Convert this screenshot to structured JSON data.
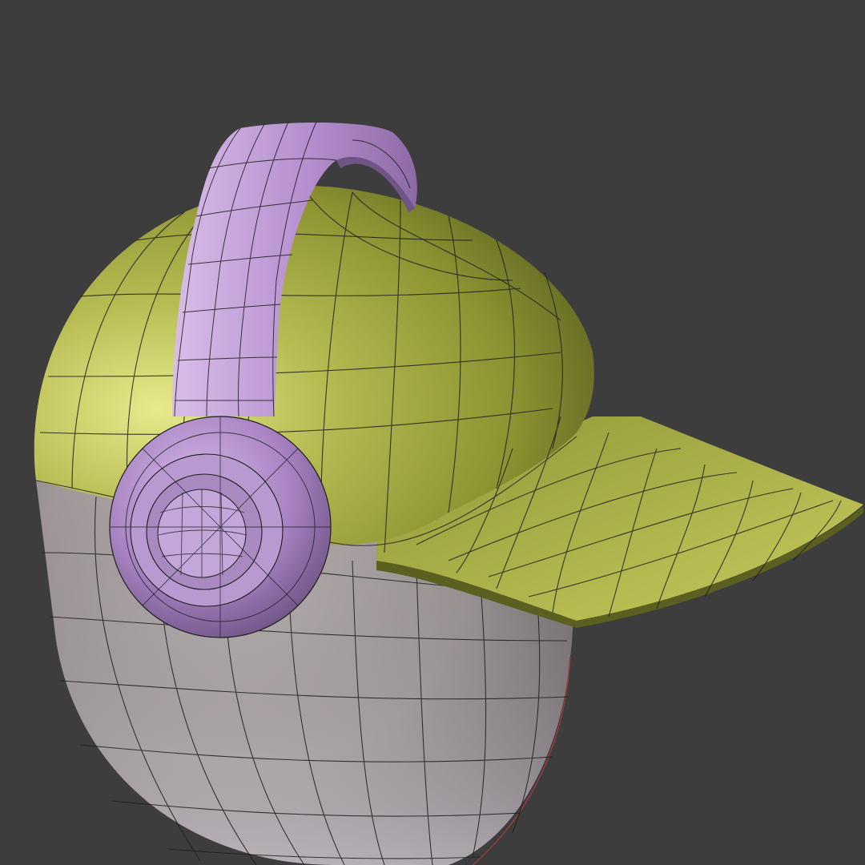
{
  "scene": {
    "objects": [
      "head",
      "baseball-cap",
      "headphones"
    ],
    "colors": {
      "background": "#3d3d3d",
      "head": "#b7adad",
      "cap": "#9aa03a",
      "headphones": "#b58fce",
      "wire": "#1e1e1e",
      "seam": "#9a3b3b"
    }
  }
}
